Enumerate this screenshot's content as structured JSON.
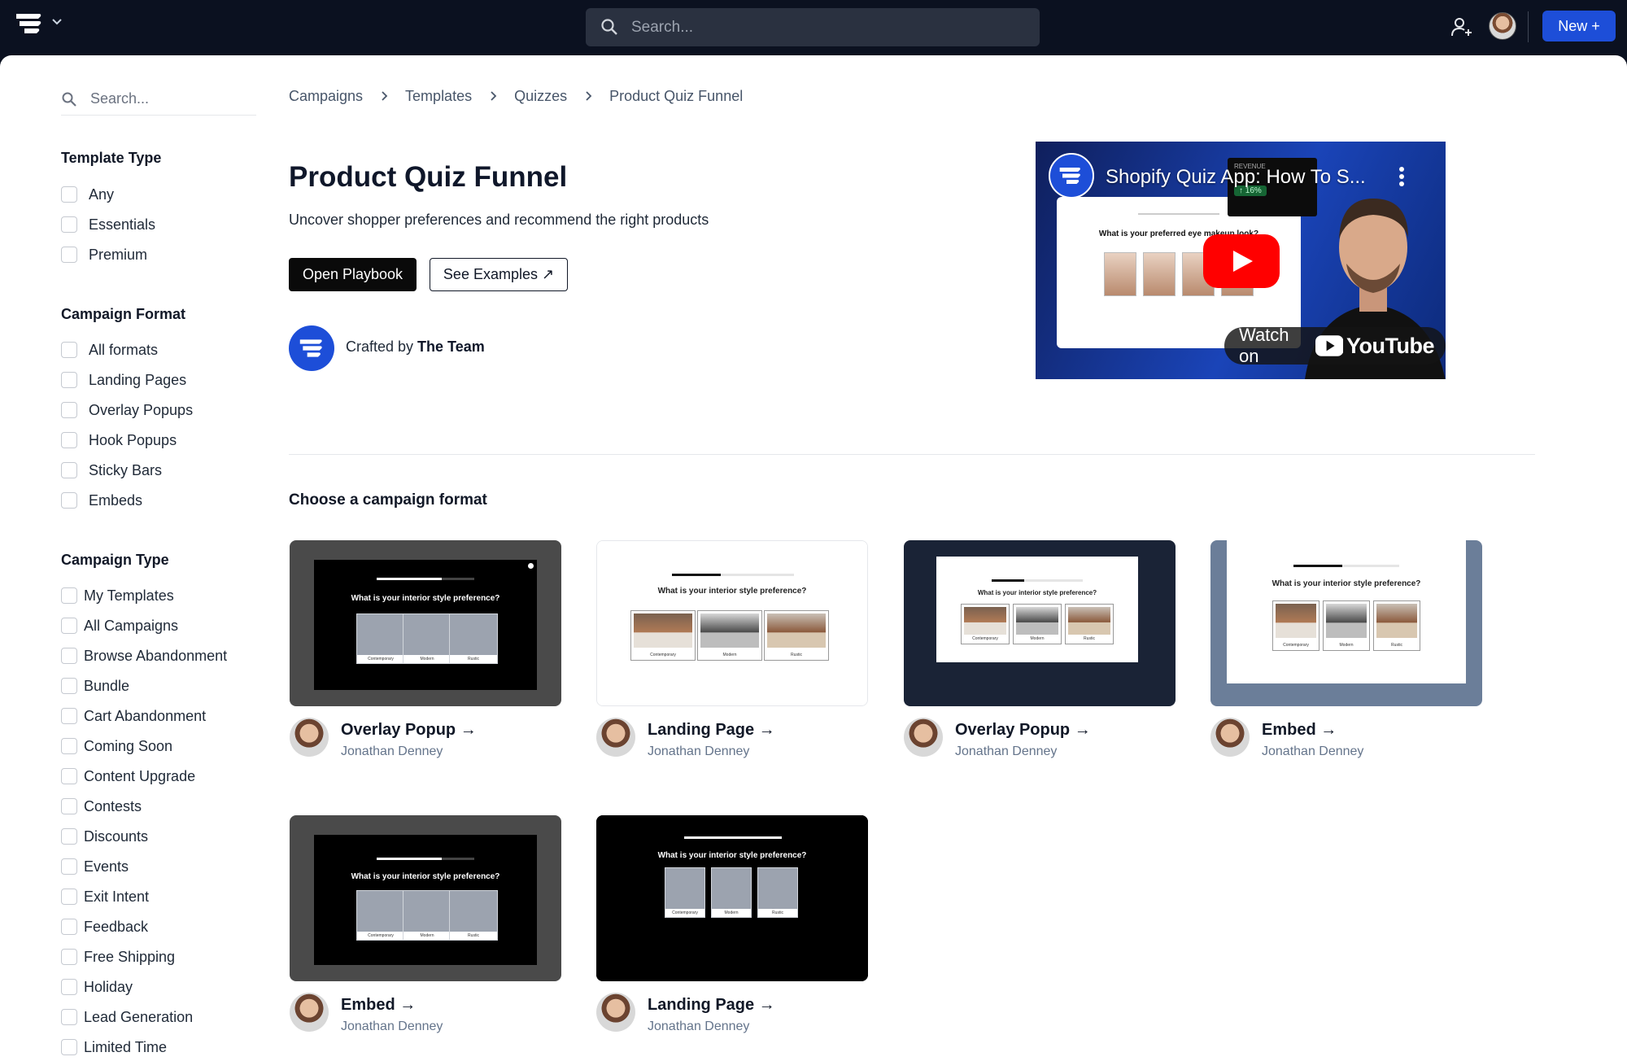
{
  "topbar": {
    "search_placeholder": "Search...",
    "new_button": "New +"
  },
  "sidebar": {
    "search_placeholder": "Search...",
    "template_type": {
      "heading": "Template Type",
      "options": [
        "Any",
        "Essentials",
        "Premium"
      ]
    },
    "campaign_format": {
      "heading": "Campaign Format",
      "options": [
        "All formats",
        "Landing Pages",
        "Overlay Popups",
        "Hook Popups",
        "Sticky Bars",
        "Embeds"
      ]
    },
    "campaign_type": {
      "heading": "Campaign Type",
      "options": [
        "My Templates",
        "All Campaigns",
        "Browse Abandonment",
        "Bundle",
        "Cart Abandonment",
        "Coming Soon",
        "Content Upgrade",
        "Contests",
        "Discounts",
        "Events",
        "Exit Intent",
        "Feedback",
        "Free Shipping",
        "Holiday",
        "Lead Generation",
        "Limited Time"
      ]
    }
  },
  "breadcrumb": [
    "Campaigns",
    "Templates",
    "Quizzes",
    "Product Quiz Funnel"
  ],
  "hero": {
    "title": "Product Quiz Funnel",
    "subtitle": "Uncover shopper preferences and recommend the right products",
    "playbook_button": "Open Playbook",
    "examples_button": "See Examples ↗",
    "crafted_prefix": "Crafted by ",
    "crafted_by": "The Team"
  },
  "video": {
    "title": "Shopify Quiz App: How To S...",
    "question": "What is your preferred eye makeup look?",
    "revenue_label": "REVENUE",
    "revenue_change": "↑ 16%",
    "watch_on": "Watch on",
    "youtube": "YouTube"
  },
  "section_title": "Choose a campaign format",
  "quiz_question": "What is your interior style preference?",
  "quiz_options": [
    "Contemporary",
    "Modern",
    "Rustic"
  ],
  "cards": [
    {
      "title": "Overlay Popup →",
      "author": "Jonathan Denney"
    },
    {
      "title": "Landing Page →",
      "author": "Jonathan Denney"
    },
    {
      "title": "Overlay Popup →",
      "author": "Jonathan Denney"
    },
    {
      "title": "Embed →",
      "author": "Jonathan Denney"
    },
    {
      "title": "Embed →",
      "author": "Jonathan Denney"
    },
    {
      "title": "Landing Page →",
      "author": "Jonathan Denney"
    }
  ],
  "colors": {
    "topbar": "#0b1120",
    "accent": "#1d4ed8",
    "text": "#111827",
    "muted": "#64748b"
  }
}
